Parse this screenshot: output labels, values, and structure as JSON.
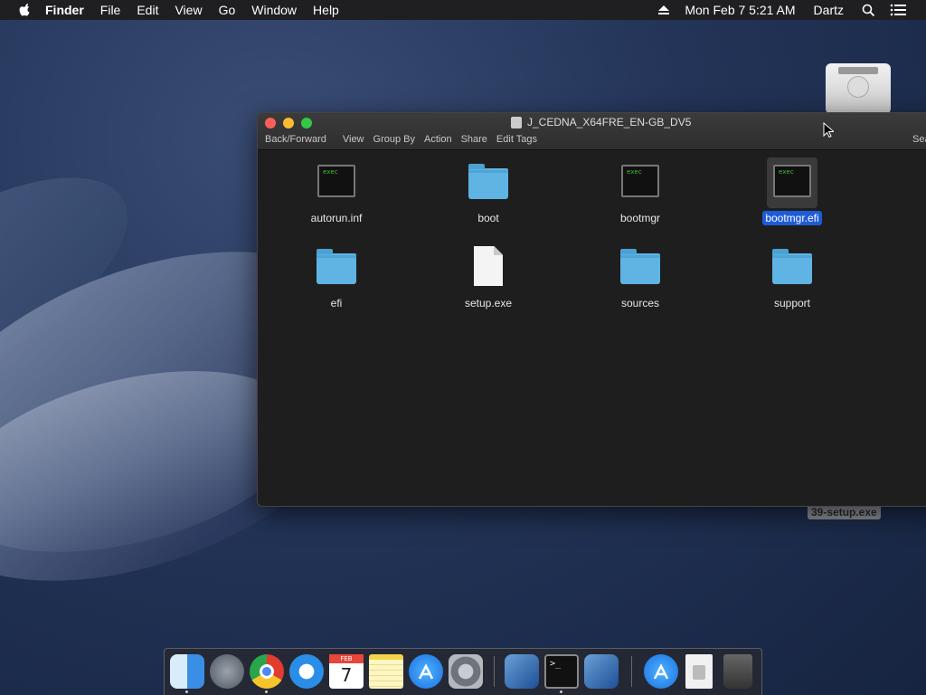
{
  "menubar": {
    "app_name": "Finder",
    "items": [
      "File",
      "Edit",
      "View",
      "Go",
      "Window",
      "Help"
    ],
    "clock": "Mon Feb 7  5:21 AM",
    "user": "Dartz"
  },
  "desktop": {
    "drive_label": "39-setup.exe"
  },
  "window": {
    "title": "J_CEDNA_X64FRE_EN-GB_DV5",
    "toolbar": {
      "back_forward": "Back/Forward",
      "view": "View",
      "group_by": "Group By",
      "action": "Action",
      "share": "Share",
      "edit_tags": "Edit Tags",
      "search": "Sea"
    },
    "files": [
      {
        "name": "autorun.inf",
        "kind": "exec",
        "icon_text": "exec"
      },
      {
        "name": "boot",
        "kind": "folder"
      },
      {
        "name": "bootmgr",
        "kind": "exec",
        "icon_text": "exec"
      },
      {
        "name": "bootmgr.efi",
        "kind": "exec",
        "icon_text": "exec",
        "selected": true
      },
      {
        "name": "efi",
        "kind": "folder"
      },
      {
        "name": "setup.exe",
        "kind": "document"
      },
      {
        "name": "sources",
        "kind": "folder"
      },
      {
        "name": "support",
        "kind": "folder"
      }
    ]
  },
  "dock": {
    "calendar_month": "FEB",
    "calendar_day": "7",
    "apps": [
      "finder-icon",
      "launchpad-icon",
      "chrome-icon",
      "safari-icon",
      "calendar-icon",
      "notes-icon",
      "app-store-icon",
      "system-preferences-icon",
      "virtualbox-icon",
      "terminal-icon",
      "virtualbox-icon",
      "app-store-downloads-icon",
      "disk-image-icon",
      "trash-icon"
    ]
  },
  "colors": {
    "selection": "#1e5bd6",
    "folder": "#5fb4e3",
    "menubar": "#1f1f22"
  }
}
